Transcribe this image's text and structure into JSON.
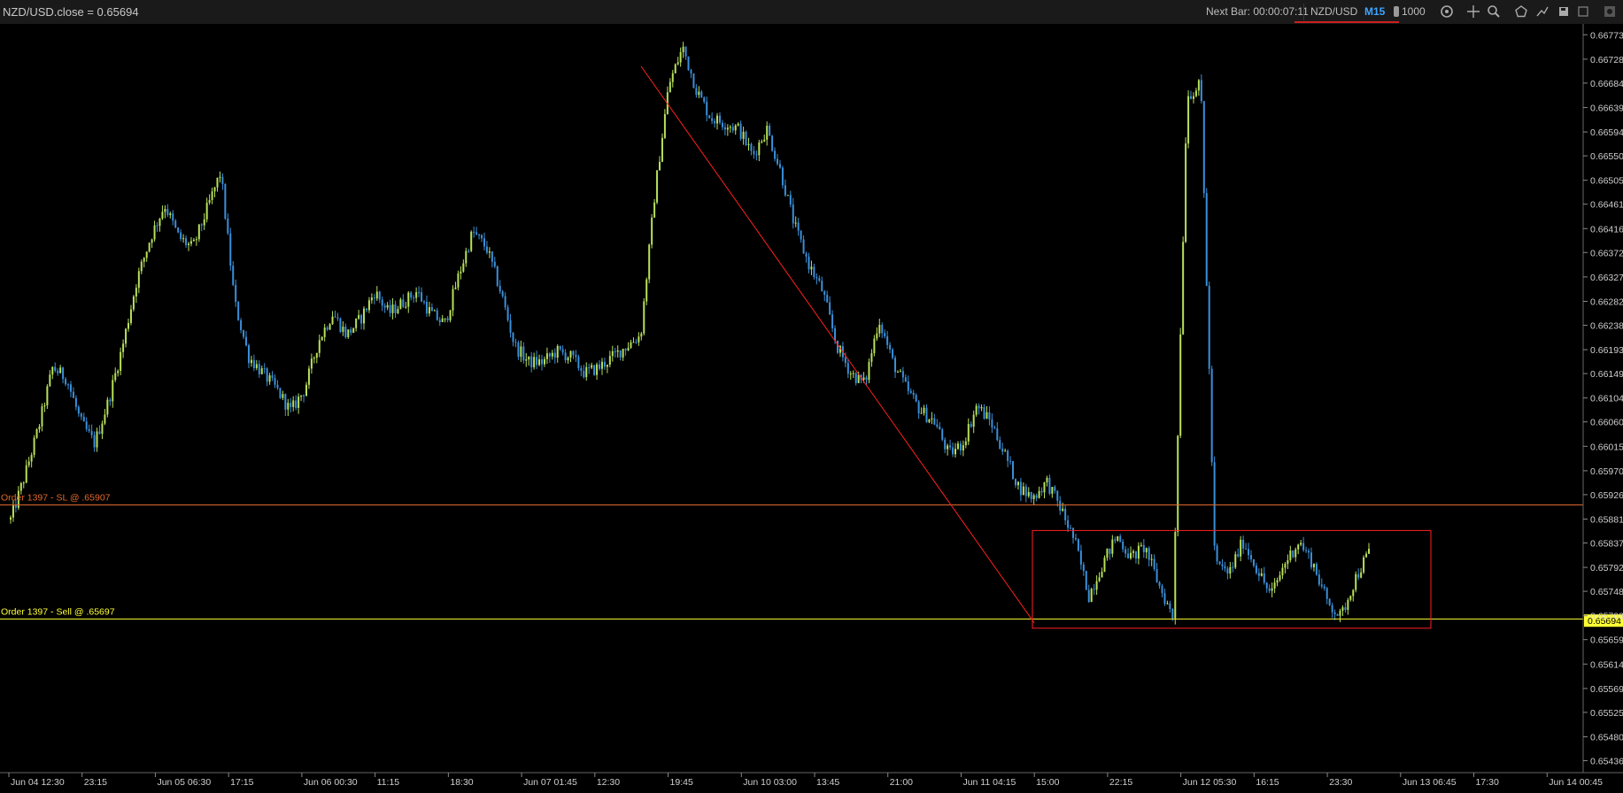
{
  "header": {
    "symbol_close": "NZD/USD.close = 0.65694",
    "next_bar": "Next Bar: 00:00:07:11",
    "pair": "NZD/USD",
    "timeframe": "M15",
    "quantity": "1000"
  },
  "colors": {
    "background": "#000000",
    "bull": "#b8e05a",
    "bear": "#3b8fd9",
    "sl_line": "#e0682a",
    "entry_line": "#ffff33",
    "annotation": "#ff2020"
  },
  "icons": [
    "sync-icon",
    "crosshair-icon",
    "zoom-icon",
    "pentagon-icon",
    "draw-icon",
    "save-icon",
    "screenshot-icon",
    "settings-icon"
  ],
  "orders": {
    "sl_label": "Order 1397 - SL @ .65907",
    "entry_label": "Order 1397 - Sell @ .65697",
    "sl_price": 0.65907,
    "entry_price": 0.65697
  },
  "chart_data": {
    "type": "candlestick",
    "title": "",
    "ylim": [
      0.65414,
      0.66793
    ],
    "y_ticks": [
      "0.66773",
      "0.66728",
      "0.66684",
      "0.66639",
      "0.66594",
      "0.66550",
      "0.66505",
      "0.66461",
      "0.66416",
      "0.66372",
      "0.66327",
      "0.66282",
      "0.66238",
      "0.66193",
      "0.66149",
      "0.66104",
      "0.66060",
      "0.66015",
      "0.65970",
      "0.65926",
      "0.65881",
      "0.65837",
      "0.65792",
      "0.65748",
      "0.65703",
      "0.65659",
      "0.65614",
      "0.65569",
      "0.65525",
      "0.65480",
      "0.65436"
    ],
    "current_price": "0.65694",
    "x_ticks": [
      "Jun 04 12:30",
      "23:15",
      "Jun 05 06:30",
      "17:15",
      "Jun 06 00:30",
      "11:15",
      "18:30",
      "Jun 07 01:45",
      "12:30",
      "19:45",
      "Jun 10 03:00",
      "13:45",
      "21:00",
      "Jun 11 04:15",
      "15:00",
      "22:15",
      "Jun 12 05:30",
      "16:15",
      "23:30",
      "Jun 13 06:45",
      "17:30",
      "Jun 14 00:45"
    ],
    "series": [
      {
        "values": [
          0.6588,
          0.6596,
          0.6605,
          0.6616,
          0.6614,
          0.6606,
          0.6602,
          0.661,
          0.662,
          0.6632,
          0.664,
          0.6646,
          0.664,
          0.6638,
          0.6645,
          0.6652,
          0.6628,
          0.6618,
          0.6615,
          0.6612,
          0.6608,
          0.6612,
          0.6621,
          0.6626,
          0.6622,
          0.6625,
          0.663,
          0.6626,
          0.6628,
          0.663,
          0.6626,
          0.6624,
          0.6633,
          0.6641,
          0.6638,
          0.663,
          0.662,
          0.6617,
          0.6617,
          0.6619,
          0.6618,
          0.6615,
          0.6616,
          0.6618,
          0.662,
          0.6622,
          0.6648,
          0.6668,
          0.6675,
          0.6667,
          0.6662,
          0.6661,
          0.666,
          0.6655,
          0.666,
          0.6652,
          0.6642,
          0.6635,
          0.663,
          0.662,
          0.6615,
          0.6613,
          0.6625,
          0.6617,
          0.6612,
          0.6608,
          0.6606,
          0.66,
          0.6602,
          0.6609,
          0.6606,
          0.66,
          0.6594,
          0.6592,
          0.6595,
          0.659,
          0.6584,
          0.6574,
          0.658,
          0.6585,
          0.6581,
          0.6583,
          0.6576,
          0.657,
          0.6666,
          0.6668,
          0.658,
          0.6578,
          0.6584,
          0.6579,
          0.6574,
          0.658,
          0.6584,
          0.658,
          0.6573,
          0.657,
          0.6577,
          0.6582
        ]
      }
    ]
  }
}
